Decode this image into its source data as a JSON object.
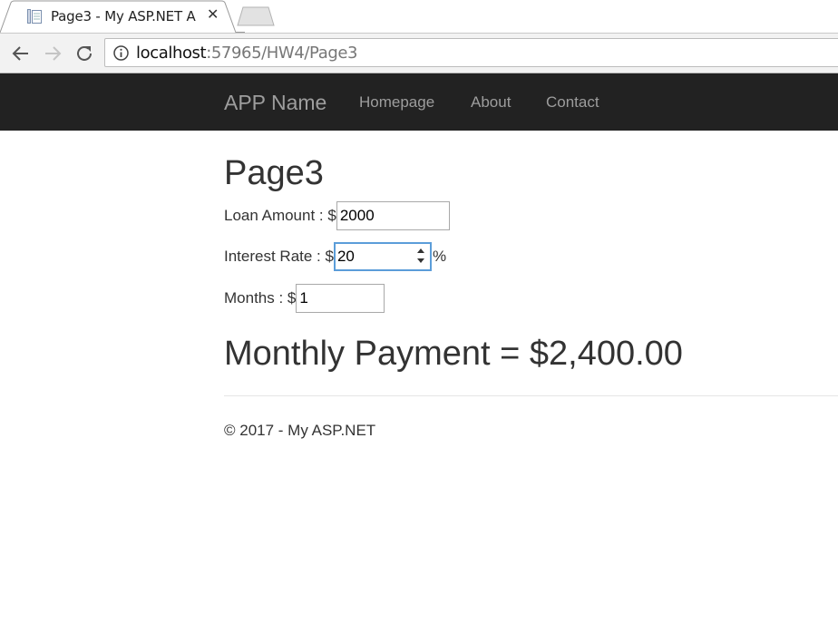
{
  "browser": {
    "tab_title": "Page3 - My ASP.NET A",
    "url_host": "localhost",
    "url_rest": ":57965/HW4/Page3"
  },
  "navbar": {
    "brand": "APP Name",
    "links": [
      "Homepage",
      "About",
      "Contact"
    ]
  },
  "page": {
    "title": "Page3",
    "loan_label": "Loan Amount : $",
    "loan_value": "2000",
    "rate_label": "Interest Rate : $",
    "rate_value": "20",
    "rate_suffix": "%",
    "months_label": "Months : $",
    "months_value": "1",
    "result": "Monthly Payment = $2,400.00",
    "footer": "© 2017 - My ASP.NET"
  },
  "icons": {
    "favicon": "page-icon",
    "close": "close-icon",
    "back": "back-arrow-icon",
    "forward": "forward-arrow-icon",
    "reload": "reload-icon",
    "info": "info-icon",
    "spinner": "spin-arrows-icon"
  }
}
